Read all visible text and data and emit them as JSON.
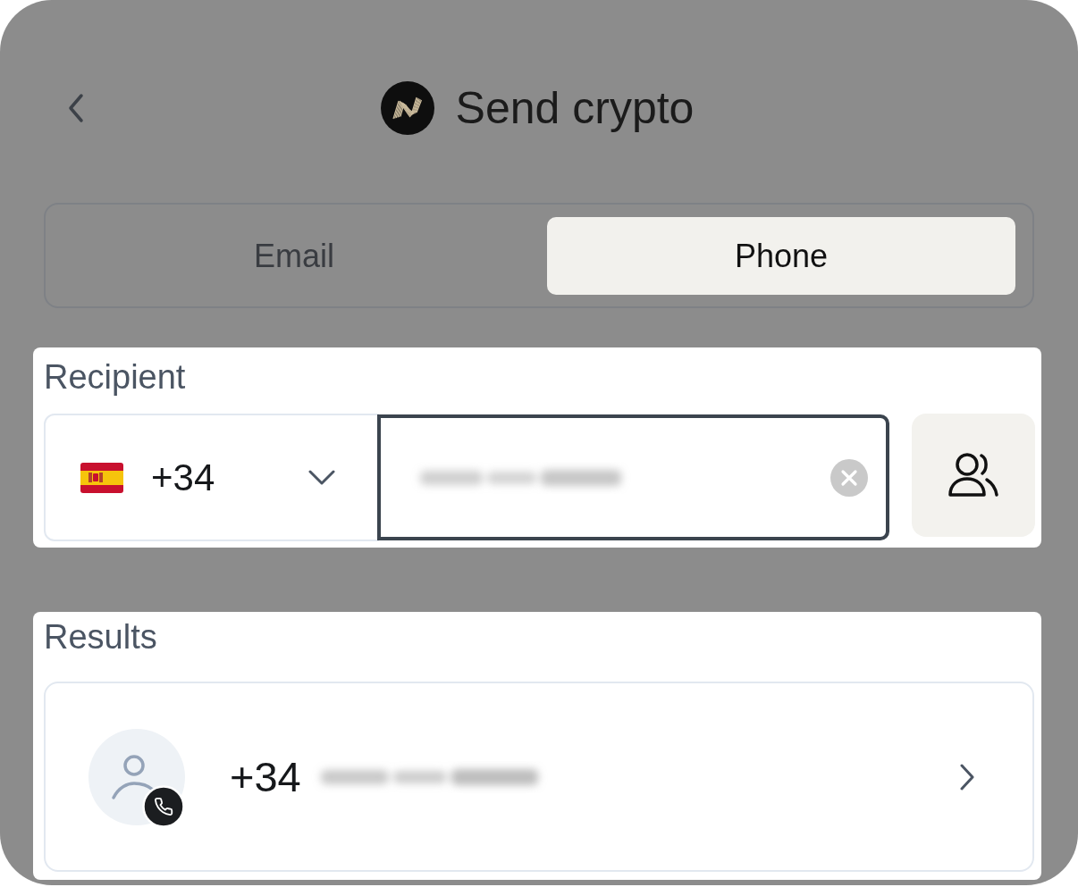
{
  "header": {
    "title": "Send crypto"
  },
  "tabs": [
    {
      "label": "Email",
      "selected": false
    },
    {
      "label": "Phone",
      "selected": true
    }
  ],
  "recipient": {
    "label": "Recipient",
    "country_code": "+34",
    "phone_field": {
      "focused": true
    }
  },
  "results": {
    "label": "Results",
    "items": [
      {
        "country_code": "+34"
      }
    ]
  }
}
